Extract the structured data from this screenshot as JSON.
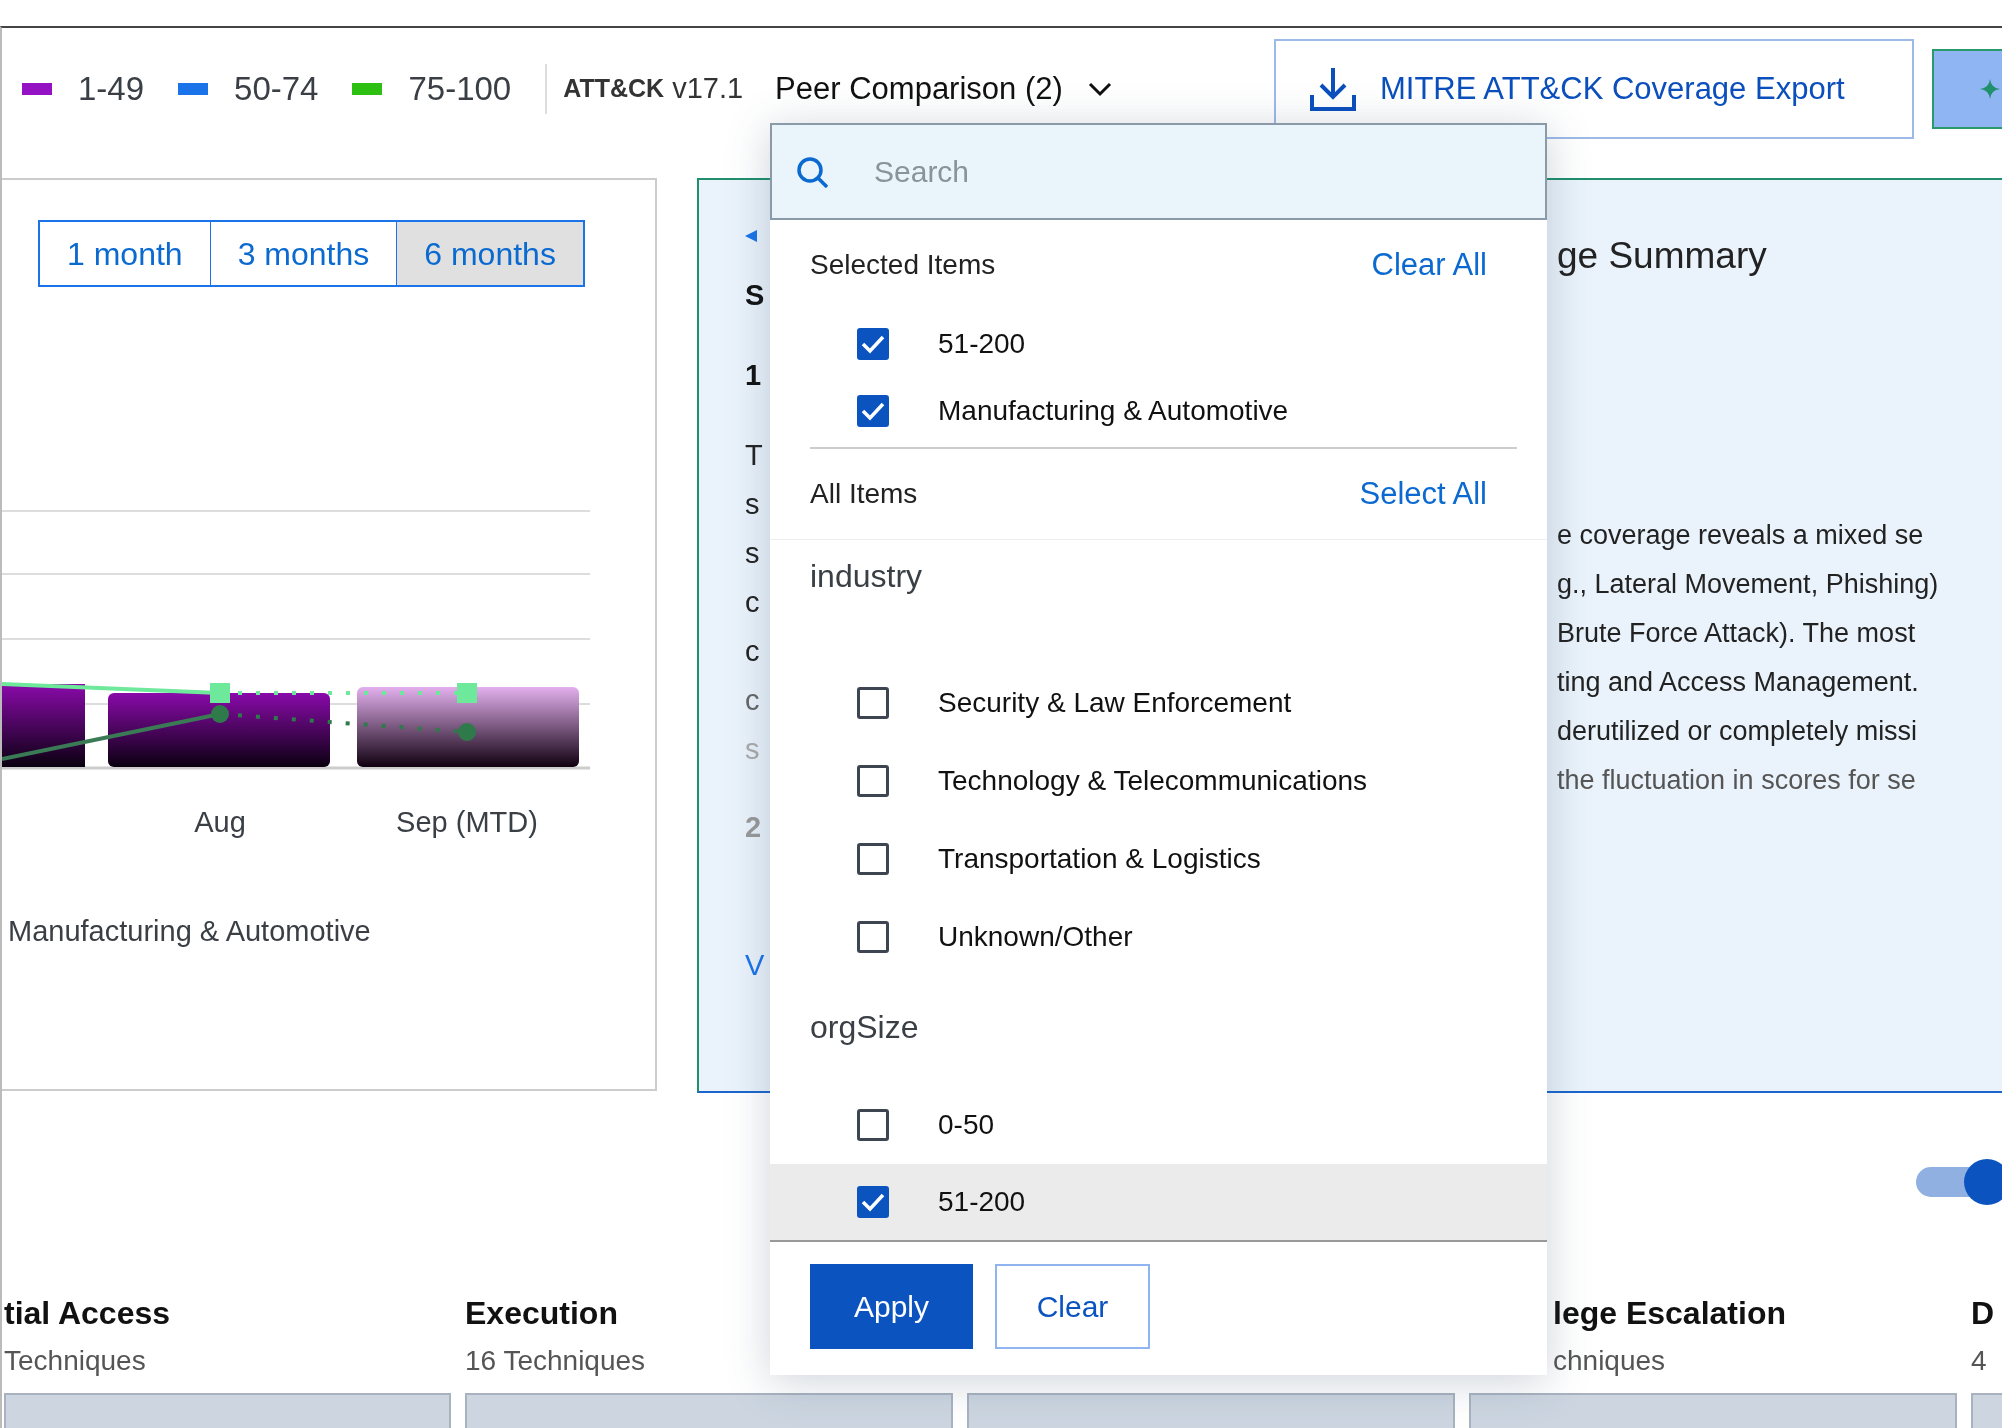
{
  "legend": [
    {
      "label": "1-49",
      "color": "#9411c4"
    },
    {
      "label": "50-74",
      "color": "#1a73e8"
    },
    {
      "label": "75-100",
      "color": "#2dbf12"
    }
  ],
  "framework": {
    "name": "ATT&CK",
    "version": "v17.1"
  },
  "peer_comparison": {
    "label": "Peer Comparison (2)",
    "expanded": true
  },
  "export_button": {
    "label": "MITRE ATT&CK Coverage Export"
  },
  "range_tabs": [
    {
      "label": "1 month",
      "selected": false
    },
    {
      "label": "3 months",
      "selected": false
    },
    {
      "label": "6 months",
      "selected": true
    }
  ],
  "chart": {
    "categories": [
      "Aug",
      "Sep (MTD)"
    ],
    "caption": "Manufacturing & Automotive"
  },
  "summary": {
    "title": "ge Summary",
    "fragments": [
      {
        "text": "S",
        "kind": "heading"
      },
      {
        "text": "1",
        "kind": "heading"
      },
      {
        "text": "T",
        "kind": "body"
      },
      {
        "text": "s",
        "kind": "body"
      },
      {
        "text": "s",
        "kind": "body"
      },
      {
        "text": "c",
        "kind": "body"
      },
      {
        "text": "c",
        "kind": "body"
      },
      {
        "text": "c",
        "kind": "muted"
      },
      {
        "text": "s",
        "kind": "faint"
      },
      {
        "text": "2",
        "kind": "number"
      },
      {
        "text": "V",
        "kind": "link"
      }
    ],
    "lines": [
      {
        "text": "e coverage reveals a mixed se",
        "muted": false
      },
      {
        "text": "g., Lateral Movement, Phishing)",
        "muted": false
      },
      {
        "text": "Brute Force Attack). The most",
        "muted": false
      },
      {
        "text": "ting and Access Management.",
        "muted": false
      },
      {
        "text": "derutilized or completely missi",
        "muted": false
      },
      {
        "text": "the fluctuation in scores for se",
        "muted": true
      }
    ]
  },
  "dropdown": {
    "search": {
      "placeholder": "Search"
    },
    "selected_header": "Selected Items",
    "clear_all": "Clear All",
    "selected_items": [
      {
        "label": "51-200",
        "checked": true
      },
      {
        "label": "Manufacturing & Automotive",
        "checked": true
      }
    ],
    "all_header": "All Items",
    "select_all": "Select All",
    "groups": [
      {
        "name": "industry",
        "items": [
          {
            "label": "Security & Law Enforcement",
            "checked": false,
            "highlighted": false
          },
          {
            "label": "Technology & Telecommunications",
            "checked": false,
            "highlighted": false
          },
          {
            "label": "Transportation & Logistics",
            "checked": false,
            "highlighted": false
          },
          {
            "label": "Unknown/Other",
            "checked": false,
            "highlighted": false
          }
        ]
      },
      {
        "name": "orgSize",
        "items": [
          {
            "label": "0-50",
            "checked": false,
            "highlighted": false
          },
          {
            "label": "51-200",
            "checked": true,
            "highlighted": true
          }
        ]
      }
    ],
    "apply": "Apply",
    "clear": "Clear"
  },
  "toggle": {
    "on": true
  },
  "tactics": [
    {
      "name": "tial Access",
      "count": "Techniques",
      "bar": true
    },
    {
      "name": "Execution",
      "count": "16 Techniques",
      "bar": true
    },
    {
      "bar": true
    },
    {
      "name": "lege Escalation",
      "count": "chniques",
      "bar": true
    },
    {
      "name": "D",
      "count": "4",
      "bar": true
    }
  ]
}
